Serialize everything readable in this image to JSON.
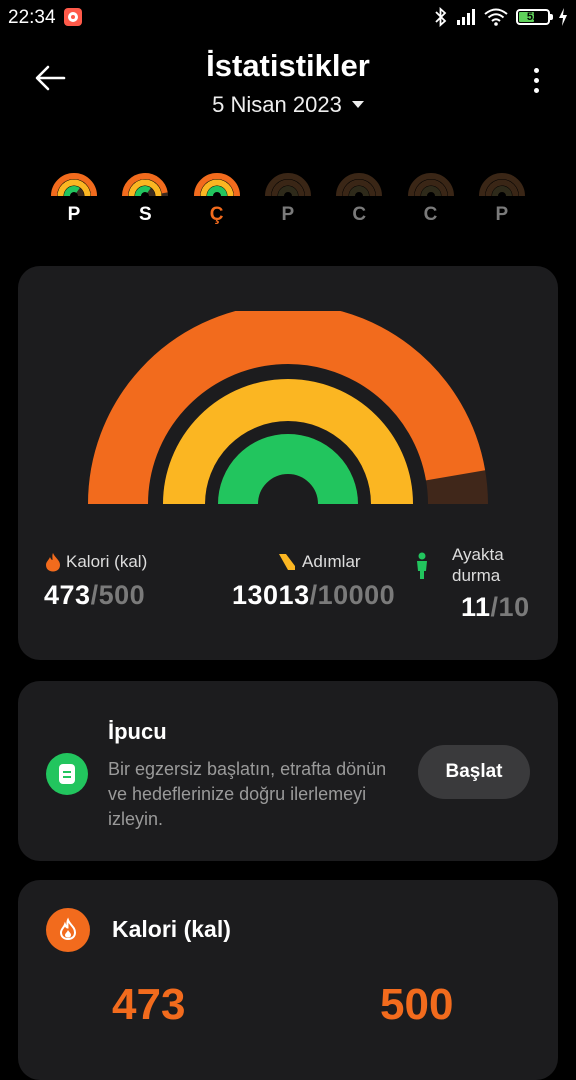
{
  "status_bar": {
    "time": "22:34",
    "battery": "52"
  },
  "header": {
    "title": "İstatistikler",
    "date": "5 Nisan 2023"
  },
  "week": [
    {
      "letter": "P",
      "active": true,
      "selected": false,
      "move": 1.0,
      "steps": 1.0,
      "stand": 0.7
    },
    {
      "letter": "S",
      "active": true,
      "selected": false,
      "move": 0.95,
      "steps": 1.0,
      "stand": 0.7
    },
    {
      "letter": "Ç",
      "active": true,
      "selected": true,
      "move": 1.0,
      "steps": 1.0,
      "stand": 1.0
    },
    {
      "letter": "P",
      "active": false,
      "selected": false
    },
    {
      "letter": "C",
      "active": false,
      "selected": false
    },
    {
      "letter": "C",
      "active": false,
      "selected": false
    },
    {
      "letter": "P",
      "active": false,
      "selected": false
    }
  ],
  "summary": {
    "calories": {
      "label": "Kalori (kal)",
      "value": "473",
      "goal": "/500",
      "progress": 0.946
    },
    "steps": {
      "label": "Adımlar",
      "value": "13013",
      "goal": "/10000",
      "progress": 1.0
    },
    "standing": {
      "label_line1": "Ayakta",
      "label_line2": "durma",
      "value": "11",
      "goal": "/10",
      "progress": 1.0
    }
  },
  "tip": {
    "title": "İpucu",
    "body": "Bir egzersiz başlatın, etrafta dönün ve hedeflerinize doğru ilerlemeyi izleyin.",
    "button": "Başlat"
  },
  "calorie_card": {
    "title": "Kalori (kal)",
    "value": "473",
    "goal": "500"
  },
  "colors": {
    "orange": "#f26b1d",
    "yellow": "#fbb622",
    "green": "#22c55e",
    "card": "#1c1c1e"
  }
}
